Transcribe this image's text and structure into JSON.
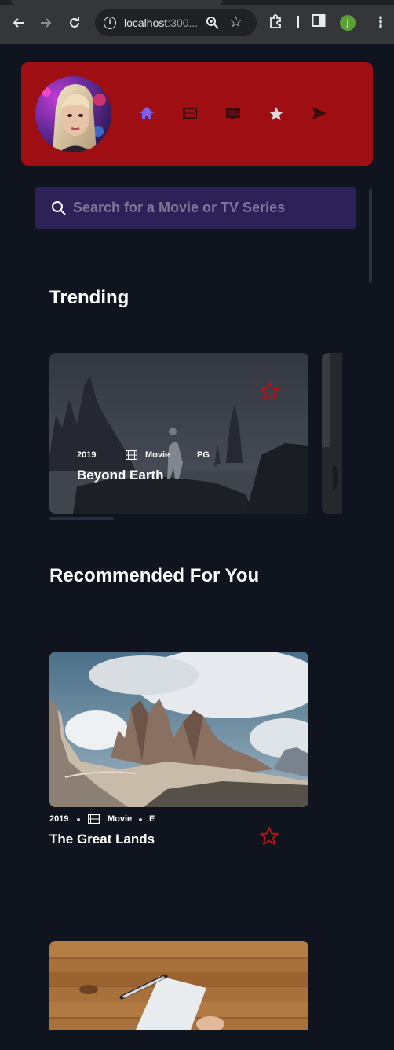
{
  "browser": {
    "url_main": "localhost",
    "url_rest": ":300...",
    "profile_initial": "j",
    "icons": [
      "back-arrow-icon",
      "forward-arrow-icon",
      "reload-icon",
      "site-info-icon",
      "zoom-icon",
      "bookmark-star-icon",
      "extensions-icon",
      "side-panel-icon",
      "profile-icon",
      "menu-kebab-icon"
    ]
  },
  "header": {
    "nav": [
      {
        "icon": "home-icon",
        "active": true
      },
      {
        "icon": "movies-icon",
        "active": false
      },
      {
        "icon": "tv-series-icon",
        "active": false
      },
      {
        "icon": "bookmark-icon",
        "active": false
      },
      {
        "icon": "send-icon",
        "active": false
      }
    ],
    "colors": {
      "bar": "#9e0e12",
      "active_icon": "#7b61e8",
      "inactive_icon": "#3a0c0e"
    }
  },
  "search": {
    "placeholder": "Search for a Movie or TV Series"
  },
  "sections": {
    "trending": "Trending",
    "recommended": "Recommended For You"
  },
  "trending": [
    {
      "year": "2019",
      "type": "Movie",
      "rating": "PG",
      "title": "Beyond Earth"
    }
  ],
  "recommended": [
    {
      "year": "2019",
      "type": "Movie",
      "rating": "E",
      "title": "The Great Lands"
    }
  ],
  "colors": {
    "background": "#10141e",
    "search_bg": "#2c2257",
    "bookmark_star": "#b0141a"
  }
}
